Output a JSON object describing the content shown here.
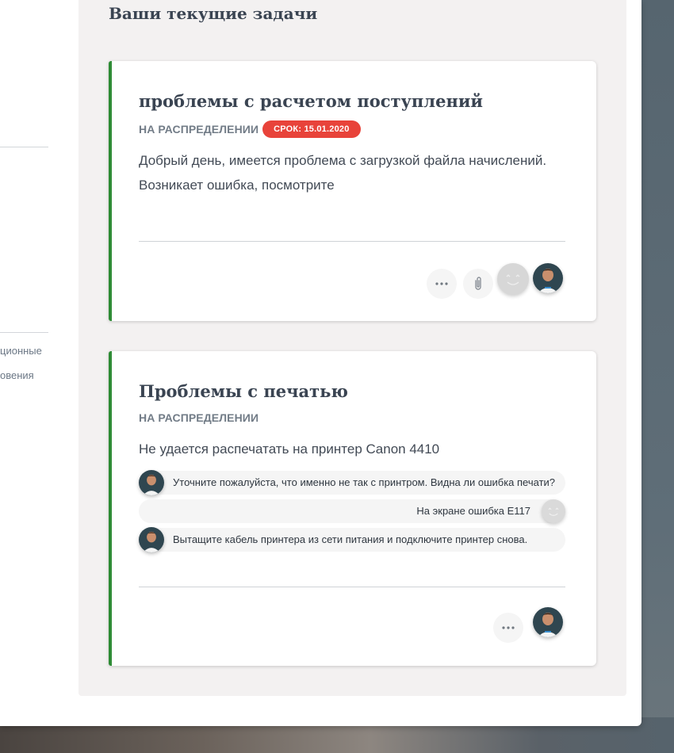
{
  "sidebar": {
    "links": [
      "ционные",
      "овения"
    ]
  },
  "main": {
    "section_title": "Ваши текущие задачи"
  },
  "tasks": [
    {
      "title": "проблемы с расчетом поступлений",
      "status": "НА РАСПРЕДЕЛЕНИИ",
      "deadline": "СРОК: 15.01.2020",
      "description": "Добрый день, имеется проблема с загрузкой файла начислений. Возникает ошибка, посмотрите",
      "actions": [
        "more-icon",
        "paperclip-icon",
        "smiley-avatar",
        "user-avatar"
      ]
    },
    {
      "title": "Проблемы с печатью",
      "status": "НА РАСПРЕДЕЛЕНИИ",
      "description": "Не удается распечатать на принтер Canon 4410",
      "messages": [
        {
          "from": "agent",
          "text": "Уточните пожалуйста, что именно не так с принтром. Видна ли ошибка печати?"
        },
        {
          "from": "user",
          "text": "На экране ошибка E117"
        },
        {
          "from": "agent",
          "text": "Вытащите кабель принтера из сети питания и подключите принтер снова."
        }
      ],
      "actions": [
        "more-icon",
        "user-avatar"
      ]
    }
  ],
  "colors": {
    "accent_border": "#2e8b35",
    "deadline_badge": "#e8433a",
    "panel_bg": "#f3f1f1"
  }
}
